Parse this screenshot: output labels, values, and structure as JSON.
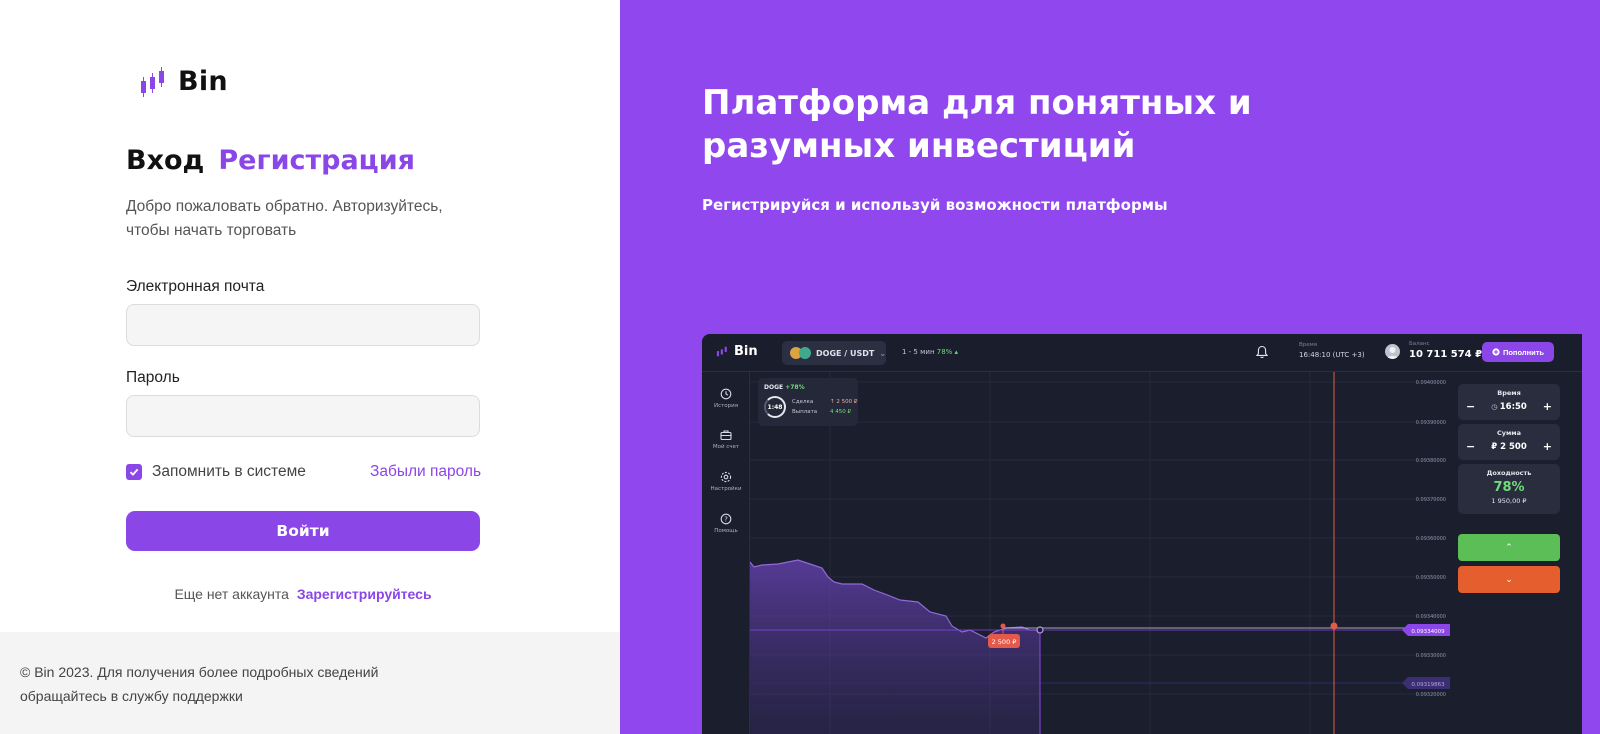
{
  "brand": {
    "name": "Bin"
  },
  "auth": {
    "tab_login": "Вход",
    "tab_register": "Регистрация",
    "welcome": "Добро пожаловать обратно. Авторизуйтесь, чтобы начать торговать",
    "email_label": "Электронная почта",
    "email_value": "",
    "password_label": "Пароль",
    "password_value": "",
    "remember_label": "Запомнить в системе",
    "remember_checked": true,
    "forgot_label": "Забыли пароль",
    "login_button": "Войти",
    "no_account_text": "Еще нет аккаунта",
    "register_link": "Зарегистрируйтесь"
  },
  "footer": {
    "text": "© Bin 2023. Для получения более подробных сведений обращайтесь в службу поддержки"
  },
  "hero": {
    "title": "Платформа для понятных и разумных инвестиций",
    "subtitle": "Регистрируйся и используй возможности платформы"
  },
  "preview": {
    "brand": "Bin",
    "pair": "DOGE / USDT",
    "timeframe": "1 - 5 мин",
    "timeframe_pct": "78% ▴",
    "time_label": "Время",
    "time_value": "16:48:10 (UTC +3)",
    "balance_label": "Баланс",
    "balance_value": "10 711 574 ₽",
    "deposit_button": "Пополнить",
    "nav": [
      "История",
      "Мой счет",
      "Настройки",
      "Помощь"
    ],
    "deal": {
      "symbol": "DOGE",
      "pct": "+78%",
      "timer": "1:48",
      "row1_label": "Сделка",
      "row1_value": "↑ 2 500 ₽",
      "row2_label": "Выплата",
      "row2_value": "4 450 ₽"
    },
    "price_ticks": [
      "0.09400000",
      "0.09390000",
      "0.09380000",
      "0.09370000",
      "0.09360000",
      "0.09350000",
      "0.09340000",
      "0.09330000",
      "0.09320000"
    ],
    "current_price": "0.09334009",
    "low_price": "0.09319863",
    "bet_marker": "2 500 ₽",
    "panel": {
      "time_label": "Время",
      "time_value": "16:50",
      "sum_label": "Сумма",
      "sum_value": "₽ 2 500",
      "yield_label": "Доходность",
      "yield_pct": "78%",
      "yield_value": "1 950,00 ₽"
    },
    "colors": {
      "accent": "#8b46e8",
      "up": "#5bbe57",
      "down": "#e55e2e",
      "bg": "#1b1e2d"
    }
  }
}
